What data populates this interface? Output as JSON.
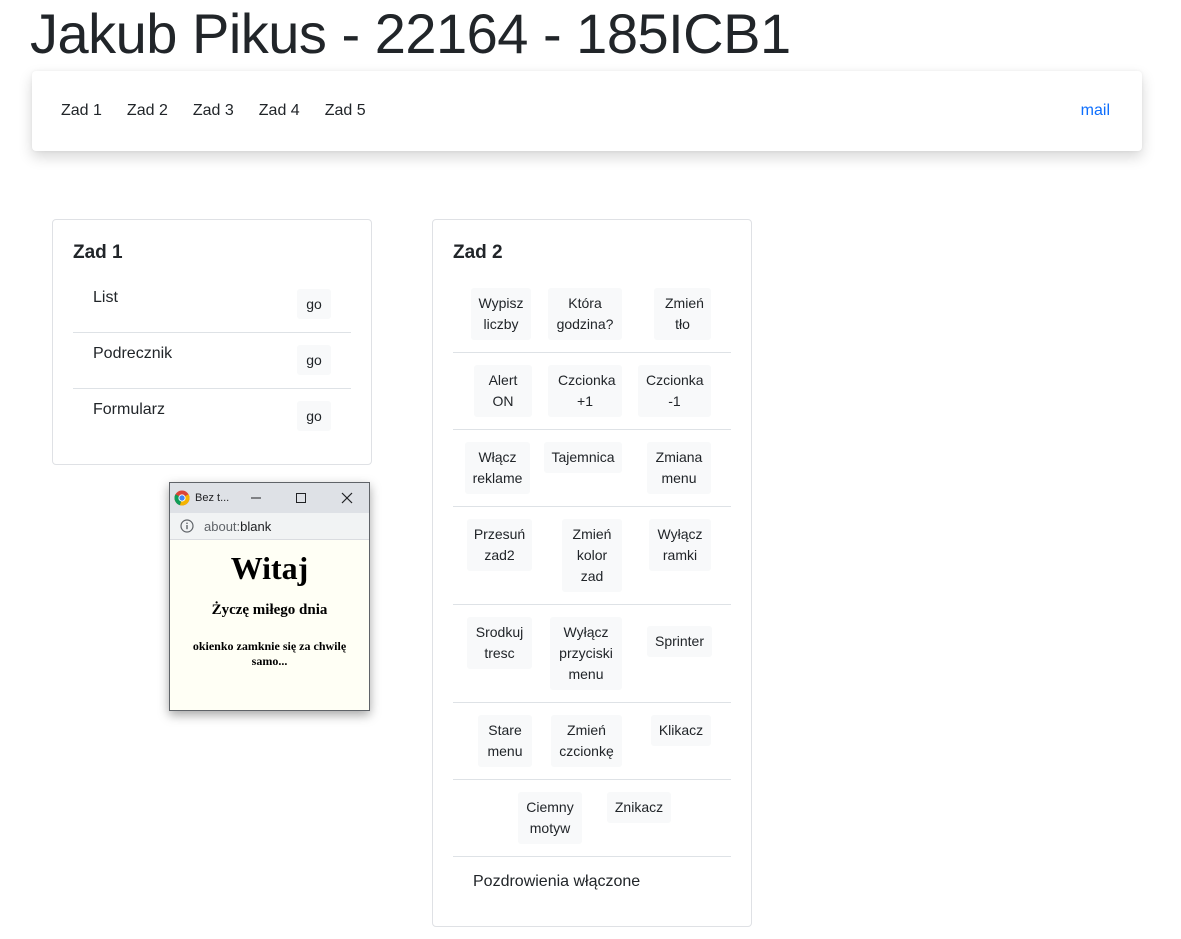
{
  "header": {
    "title": "Jakub Pikus - 22164 - 185ICB1"
  },
  "nav": {
    "links": [
      "Zad 1",
      "Zad 2",
      "Zad 3",
      "Zad 4",
      "Zad 5"
    ],
    "right_link": "mail"
  },
  "zad1": {
    "title": "Zad 1",
    "items": [
      {
        "label": "List",
        "button": "go"
      },
      {
        "label": "Podrecznik",
        "button": "go"
      },
      {
        "label": "Formularz",
        "button": "go"
      }
    ]
  },
  "zad2": {
    "title": "Zad 2",
    "buttons": [
      "Wypisz liczby",
      "Która godzina?",
      "Zmień tło",
      "Alert ON",
      "Czcionka +1",
      "Czcionka -1",
      "Włącz reklame",
      "Tajemnica",
      "Zmiana menu",
      "Przesuń zad2",
      "Zmień kolor zad",
      "Wyłącz ramki",
      "Srodkuj tresc",
      "Wyłącz przyciski menu",
      "Sprinter",
      "Stare menu",
      "Zmień czcionkę",
      "Klikacz",
      "Ciemny motyw",
      "Znikacz"
    ],
    "status": "Pozdrowienia włączone"
  },
  "popup": {
    "tab_title": "Bez t...",
    "url_scheme": "about:",
    "url_rest": "blank",
    "heading": "Witaj",
    "subheading": "Życzę miłego dnia",
    "note": "okienko zamknie się za chwilę samo..."
  },
  "colors": {
    "link": "#0d6efd",
    "button_bg": "#f8f9fa",
    "popup_bg": "#fffff5"
  }
}
